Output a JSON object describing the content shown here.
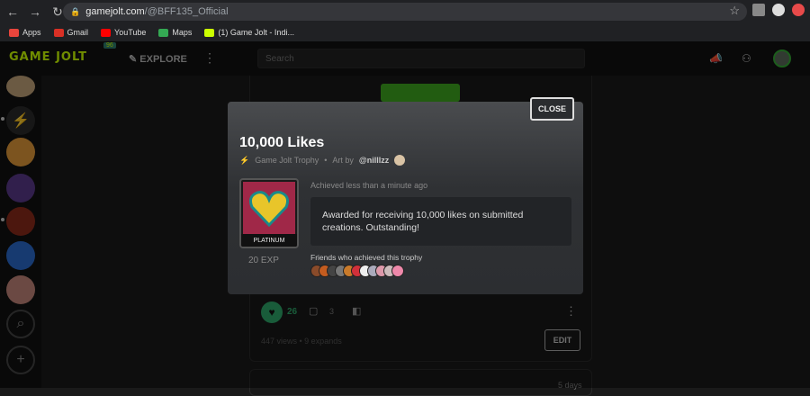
{
  "browser": {
    "url_host": "gamejolt.com",
    "url_path": "/@BFF135_Official",
    "bookmarks": [
      {
        "label": "Apps",
        "color": "#e8453c"
      },
      {
        "label": "Gmail",
        "color": "#d93025"
      },
      {
        "label": "YouTube",
        "color": "#ff0000"
      },
      {
        "label": "Maps",
        "color": "#34a853"
      },
      {
        "label": "(1) Game Jolt - Indi...",
        "color": "#ccff00"
      }
    ]
  },
  "gamejolt": {
    "logo": "GAME JOLT",
    "badge": "96",
    "explore": "EXPLORE",
    "search_placeholder": "Search"
  },
  "post": {
    "likes": "26",
    "comments": "3",
    "views": "447 views  •  9 expands",
    "edit_label": "EDIT",
    "time": "5 days"
  },
  "modal": {
    "close_label": "CLOSE",
    "title": "10,000 Likes",
    "type": "Game Jolt Trophy",
    "art_by": "Art by",
    "artist": "@nilllzz",
    "tier": "PLATINUM",
    "exp": "20 EXP",
    "achieved": "Achieved less than a minute ago",
    "description": "Awarded for receiving 10,000 likes on submitted creations. Outstanding!",
    "friends_label": "Friends who achieved this trophy",
    "friend_colors": [
      "#8a4b2a",
      "#c45c1f",
      "#444",
      "#777",
      "#c97a2a",
      "#d1303a",
      "#eee",
      "#aab",
      "#d9a",
      "#cbb",
      "#e8a"
    ]
  },
  "colors": {
    "accent": "#ccff00",
    "like_green": "#2fa86a"
  }
}
